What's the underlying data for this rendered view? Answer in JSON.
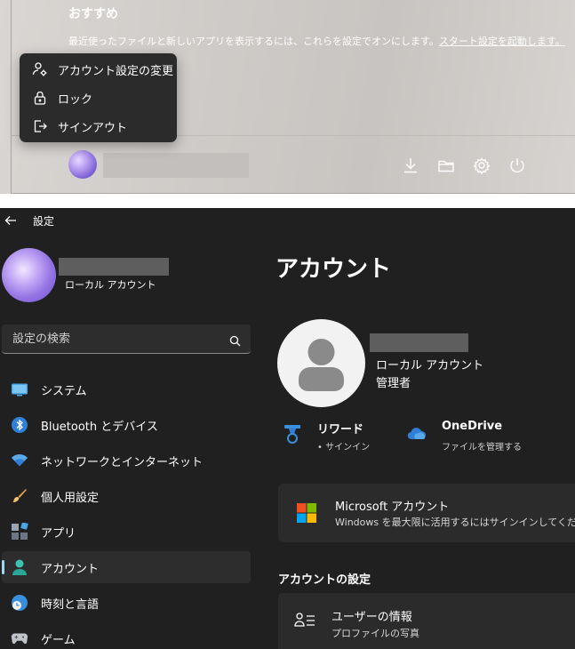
{
  "start_menu": {
    "recommended_title": "おすすめ",
    "recommended_desc": "最近使ったファイルと新しいアプリを表示するには、これらを設定でオンにします。",
    "recommended_link": "スタート設定を起動します。",
    "user_menu": {
      "items": [
        {
          "label": "アカウント設定の変更",
          "icon": "person-gear-icon"
        },
        {
          "label": "ロック",
          "icon": "lock-icon"
        },
        {
          "label": "サインアウト",
          "icon": "sign-out-icon"
        }
      ]
    },
    "footer_icons": [
      "download-icon",
      "folder-icon",
      "gear-icon",
      "power-icon"
    ]
  },
  "settings": {
    "window_title": "設定",
    "profile": {
      "type": "ローカル アカウント"
    },
    "search": {
      "placeholder": "設定の検索"
    },
    "nav": {
      "items": [
        {
          "label": "システム",
          "icon": "monitor-icon"
        },
        {
          "label": "Bluetooth とデバイス",
          "icon": "bluetooth-icon"
        },
        {
          "label": "ネットワークとインターネット",
          "icon": "wifi-icon"
        },
        {
          "label": "個人用設定",
          "icon": "paintbrush-icon"
        },
        {
          "label": "アプリ",
          "icon": "apps-icon"
        },
        {
          "label": "アカウント",
          "icon": "person-icon",
          "selected": true
        },
        {
          "label": "時刻と言語",
          "icon": "clock-globe-icon"
        },
        {
          "label": "ゲーム",
          "icon": "gamepad-icon"
        }
      ]
    },
    "main": {
      "page_title": "アカウント",
      "account_type": "ローカル アカウント",
      "account_role": "管理者",
      "rewards": {
        "title": "リワード",
        "sub": "• サインイン"
      },
      "onedrive": {
        "title": "OneDrive",
        "sub": "ファイルを管理する"
      },
      "ms_account": {
        "title": "Microsoft アカウント",
        "sub": "Windows を最大限に活用するにはサインインしてください"
      },
      "section_title": "アカウントの設定",
      "user_info": {
        "title": "ユーザーの情報",
        "sub": "プロファイルの写真"
      }
    },
    "colors": {
      "accent": "#9ed8f5",
      "background": "#202020",
      "card": "#2b2b2b"
    }
  }
}
